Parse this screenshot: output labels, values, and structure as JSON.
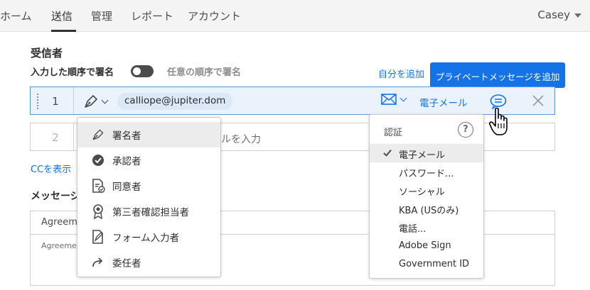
{
  "nav": {
    "items": [
      {
        "label": "ホーム"
      },
      {
        "label": "送信"
      },
      {
        "label": "管理"
      },
      {
        "label": "レポート"
      },
      {
        "label": "アカウント"
      }
    ],
    "user": "Casey"
  },
  "recipients": {
    "title": "受信者",
    "order_label": "入力した順序で署名",
    "any_order_label": "任意の順序で署名",
    "add_me": "自分を追加",
    "tooltip": "プライベートメッセージを追加",
    "rows": [
      {
        "number": "1",
        "email": "calliope@jupiter.dom",
        "auth": "電子メール"
      },
      {
        "number": "2",
        "placeholder": "ルを入力"
      }
    ],
    "cc_link": "CCを表示"
  },
  "message": {
    "title": "メッセージ",
    "name_prefix": "Agreem",
    "body_prefix": "Agreeme"
  },
  "role_menu": {
    "items": [
      {
        "label": "署名者",
        "icon": "pen-icon",
        "highlighted": true
      },
      {
        "label": "承認者",
        "icon": "check-circle-icon"
      },
      {
        "label": "同意者",
        "icon": "document-check-icon"
      },
      {
        "label": "第三者確認担当者",
        "icon": "ribbon-icon"
      },
      {
        "label": "フォーム入力者",
        "icon": "form-edit-icon"
      },
      {
        "label": "委任者",
        "icon": "forward-arrow-icon"
      }
    ]
  },
  "auth_menu": {
    "title": "認証",
    "items": [
      {
        "label": "電子メール",
        "selected": true
      },
      {
        "label": "パスワード..."
      },
      {
        "label": "ソーシャル"
      },
      {
        "label": "KBA (USのみ)"
      },
      {
        "label": "電話..."
      },
      {
        "label": "Adobe Sign"
      },
      {
        "label": "Government ID"
      }
    ]
  },
  "colors": {
    "accent": "#1473e6",
    "text": "#2c2c2c",
    "border": "#d0d0d0"
  }
}
